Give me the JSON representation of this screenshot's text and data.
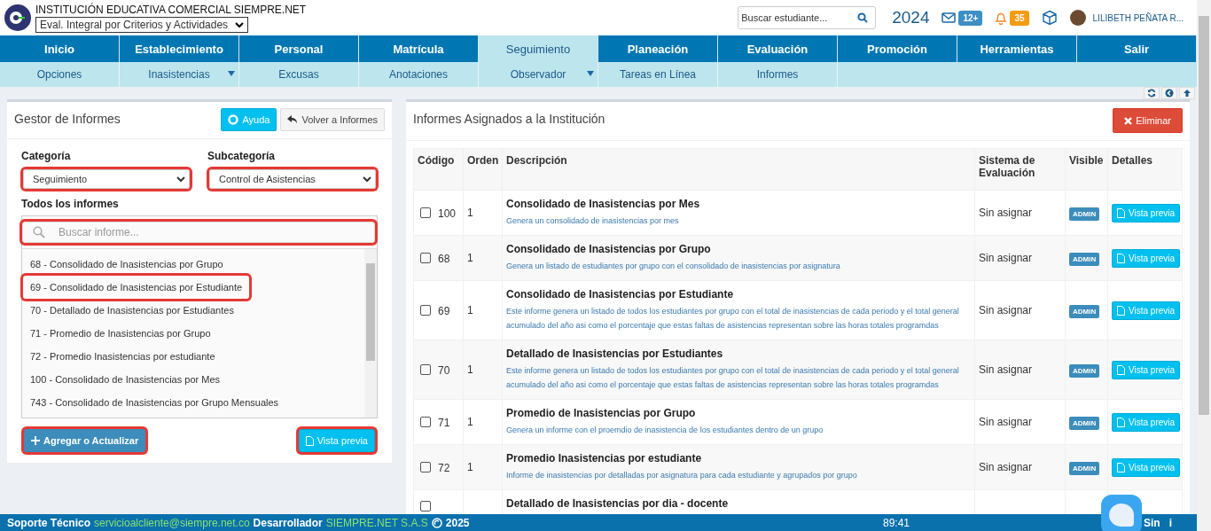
{
  "header": {
    "institution": "INSTITUCIÓN EDUCATIVA COMERCIAL SIEMPRE.NET",
    "evaluation_select": "Eval. Integral por Criterios y Actividades",
    "search": {
      "placeholder": "Buscar estudiante..."
    },
    "year": "2024",
    "messages_badge": "12+",
    "notifications_badge": "35",
    "user_name": "LILIBETH PEÑATA R..."
  },
  "nav": [
    {
      "label": "Inicio",
      "selected": false
    },
    {
      "label": "Establecimiento",
      "selected": false
    },
    {
      "label": "Personal",
      "selected": false
    },
    {
      "label": "Matrícula",
      "selected": false
    },
    {
      "label": "Seguimiento",
      "selected": true
    },
    {
      "label": "Planeación",
      "selected": false
    },
    {
      "label": "Evaluación",
      "selected": false
    },
    {
      "label": "Promoción",
      "selected": false
    },
    {
      "label": "Herramientas",
      "selected": false
    },
    {
      "label": "Salir",
      "selected": false
    }
  ],
  "subnav": [
    {
      "label": "Opciones",
      "dropdown": false
    },
    {
      "label": "Inasistencias",
      "dropdown": true
    },
    {
      "label": "Excusas",
      "dropdown": false
    },
    {
      "label": "Anotaciones",
      "dropdown": false
    },
    {
      "label": "Observador",
      "dropdown": true
    },
    {
      "label": "Tareas en Línea",
      "dropdown": false
    },
    {
      "label": "Informes",
      "dropdown": false
    }
  ],
  "left_panel": {
    "title": "Gestor de Informes",
    "help_button": "Ayuda",
    "back_button": "Volver a Informes",
    "category": {
      "label": "Categoría",
      "value": "Seguimiento",
      "highlighted": true
    },
    "subcategory": {
      "label": "Subcategoría",
      "value": "Control de Asistencias",
      "highlighted": true
    },
    "list_label": "Todos los informes",
    "list_search": {
      "placeholder": "Buscar informe...",
      "highlighted": true
    },
    "reports": [
      {
        "label": "68 - Consolidado de Inasistencias por Grupo",
        "selected": false
      },
      {
        "label": "69 - Consolidado de Inasistencias por Estudiante",
        "selected": true
      },
      {
        "label": "70 - Detallado de Inasistencias por Estudiantes",
        "selected": false
      },
      {
        "label": "71 - Promedio de Inasistencias por Grupo",
        "selected": false
      },
      {
        "label": "72 - Promedio Inasistencias por estudiante",
        "selected": false
      },
      {
        "label": "100 - Consolidado de Inasistencias por Mes",
        "selected": false
      },
      {
        "label": "743 - Consolidado de Inasistencias por Grupo Mensuales",
        "selected": false
      }
    ],
    "add_button": {
      "label": "Agregar o Actualizar",
      "highlighted": true
    },
    "preview_button": {
      "label": "Vista previa",
      "highlighted": true
    }
  },
  "right_panel": {
    "title": "Informes Asignados a la Institución",
    "delete_button": "Eliminar",
    "columns": [
      "Código",
      "Orden",
      "Descripción",
      "Sistema de Evaluación",
      "Visible",
      "Detalles"
    ],
    "rows": [
      {
        "checked": false,
        "code": "100",
        "order": "1",
        "title": "Consolidado de Inasistencias por Mes",
        "description": "Genera un consolidado de inasistencias por mes",
        "system": "Sin asignar",
        "visible": "ADMIN",
        "details": "Vista previa"
      },
      {
        "checked": false,
        "code": "68",
        "order": "1",
        "title": "Consolidado de Inasistencias por Grupo",
        "description": "Genera un listado de estudiantes por grupo con el consolidado de inasistencias por asignatura",
        "system": "Sin asignar",
        "visible": "ADMIN",
        "details": "Vista previa"
      },
      {
        "checked": false,
        "code": "69",
        "order": "1",
        "title": "Consolidado de Inasistencias por Estudiante",
        "description": "Este informe genera un listado de todos los estudiantes por grupo con el total de inasistencias de cada periodo y el total general acumulado del año asi como el porcentaje que estas faltas de asistencias representan sobre las horas totales programdas",
        "system": "Sin asignar",
        "visible": "ADMIN",
        "details": "Vista previa"
      },
      {
        "checked": false,
        "code": "70",
        "order": "1",
        "title": "Detallado de Inasistencias por Estudiantes",
        "description": "Este informe genera un listado de todos los estudiantes por grupo con el total de inasistencias de cada periodo y el total general acumulado del año asi como el porcentaje que estas faltas de asistencias representan sobre las horas totales programdas",
        "system": "Sin asignar",
        "visible": "ADMIN",
        "details": "Vista previa"
      },
      {
        "checked": false,
        "code": "71",
        "order": "1",
        "title": "Promedio de Inasistencias por Grupo",
        "description": "Genera un informe con el proemdio de inasistencia de los estudiantes dentro de un grupo",
        "system": "Sin asignar",
        "visible": "ADMIN",
        "details": "Vista previa"
      },
      {
        "checked": false,
        "code": "72",
        "order": "1",
        "title": "Promedio Inasistencias por estudiante",
        "description": "Informe de inasistencias por detalladas por asignatura para cada estudiante y agrupados por grupo",
        "system": "Sin asignar",
        "visible": "ADMIN",
        "details": "Vista previa"
      },
      {
        "checked": false,
        "title": "Detallado de Inasistencias por dia - docente"
      }
    ]
  },
  "footer": {
    "support_label": "Soporte Técnico",
    "support_email": "servicioalcliente@siempre.net.co",
    "developer_label": "Desarrollador",
    "developer": "SIEMPRE.NET S.A.S",
    "year": "2025",
    "timer": "89:41",
    "brand": "Sin",
    "brand_suffix": "i"
  }
}
